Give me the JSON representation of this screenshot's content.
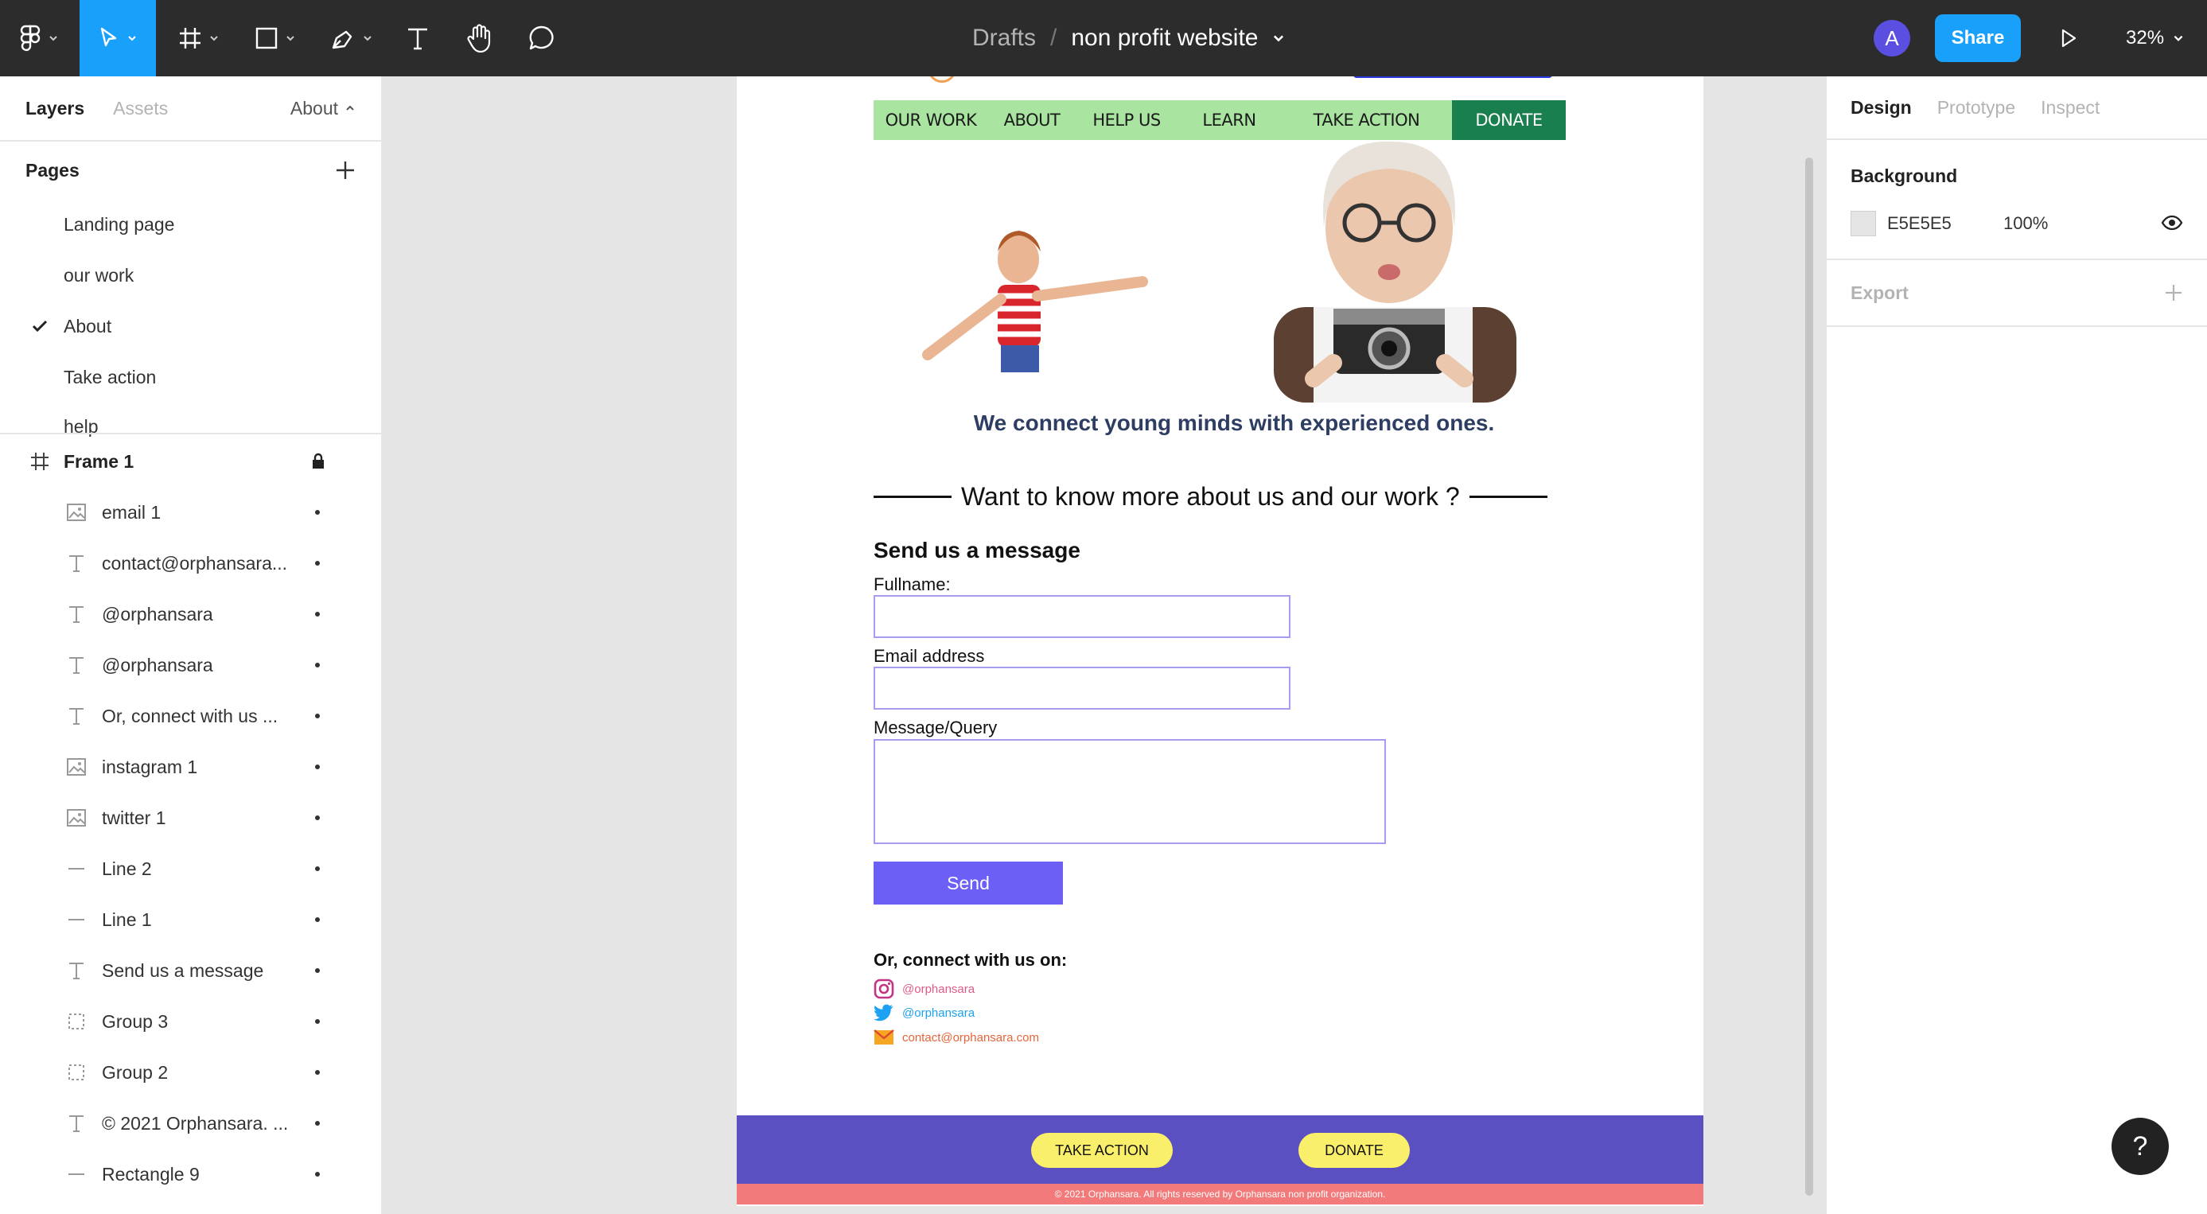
{
  "toolbar": {
    "breadcrumb_root": "Drafts",
    "breadcrumb_sep": "/",
    "file_name": "non profit website",
    "avatar_initial": "A",
    "share_label": "Share",
    "zoom": "32%",
    "accent_color": "#18a0fb"
  },
  "left_panel": {
    "tabs": [
      "Layers",
      "Assets"
    ],
    "current_page": "About",
    "pages_title": "Pages",
    "pages": [
      "Landing page",
      "our work",
      "About",
      "Take action",
      "help"
    ],
    "frame_name": "Frame 1",
    "layers": [
      {
        "name": "email 1",
        "icon": "image-icon"
      },
      {
        "name": "contact@orphansara...",
        "icon": "text-icon"
      },
      {
        "name": "@orphansara",
        "icon": "text-icon"
      },
      {
        "name": "@orphansara",
        "icon": "text-icon"
      },
      {
        "name": "Or, connect with us ...",
        "icon": "text-icon"
      },
      {
        "name": "instagram 1",
        "icon": "image-icon"
      },
      {
        "name": "twitter 1",
        "icon": "image-icon"
      },
      {
        "name": "Line 2",
        "icon": "line-icon"
      },
      {
        "name": "Line 1",
        "icon": "line-icon"
      },
      {
        "name": "Send us a message",
        "icon": "text-icon"
      },
      {
        "name": "Group 3",
        "icon": "group-icon"
      },
      {
        "name": "Group 2",
        "icon": "group-icon"
      },
      {
        "name": "© 2021 Orphansara. ...",
        "icon": "text-icon"
      },
      {
        "name": "Rectangle 9",
        "icon": "line-icon"
      }
    ]
  },
  "right_panel": {
    "tabs": [
      "Design",
      "Prototype",
      "Inspect"
    ],
    "background_title": "Background",
    "background_hex": "E5E5E5",
    "background_opacity": "100%",
    "export_title": "Export"
  },
  "canvas": {
    "nav": [
      "OUR WORK",
      "ABOUT",
      "HELP US",
      "LEARN",
      "TAKE ACTION",
      "DONATE"
    ],
    "tagline": "We connect young minds with experienced ones.",
    "more_heading": "Want to know more about us and our work ?",
    "send_title": "Send us a message",
    "label_fullname": "Fullname:",
    "label_email": "Email address",
    "label_message": "Message/Query",
    "send_label": "Send",
    "connect_title": "Or, connect with us on:",
    "instagram_handle": "@orphansara",
    "twitter_handle": "@orphansara",
    "email_contact": "contact@orphansara.com",
    "footer_take_action": "TAKE ACTION",
    "footer_donate": "DONATE",
    "copyright": "© 2021 Orphansara. All rights reserved by Orphansara non profit organization.",
    "colors": {
      "nav_bg": "#a9e4a1",
      "donate_bg": "#1a7f4e",
      "send_bg": "#6c5ff5",
      "footer_bg": "#5a50c2",
      "footer_btn": "#f9ef6a",
      "copyright_bg": "#f27a7a"
    }
  }
}
